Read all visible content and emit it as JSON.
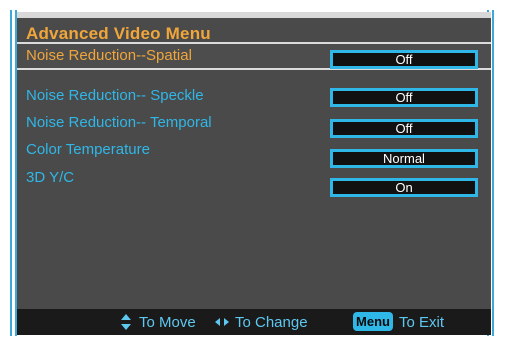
{
  "menu": {
    "title": "Advanced Video Menu",
    "items": [
      {
        "label": "Noise Reduction--Spatial",
        "value": "Off",
        "selected": true
      },
      {
        "label": "Noise Reduction-- Speckle",
        "value": "Off",
        "selected": false
      },
      {
        "label": "Noise Reduction-- Temporal",
        "value": "Off",
        "selected": false
      },
      {
        "label": "Color Temperature",
        "value": "Normal",
        "selected": false
      },
      {
        "label": "3D  Y/C",
        "value": "On",
        "selected": false
      }
    ]
  },
  "footer": {
    "move_text": "To Move",
    "change_text": "To Change",
    "menu_key": "Menu",
    "exit_text": "To Exit"
  },
  "colors": {
    "accent": "#2fb7e8",
    "selected_text": "#f0a63a",
    "background": "#4a4a4a"
  }
}
